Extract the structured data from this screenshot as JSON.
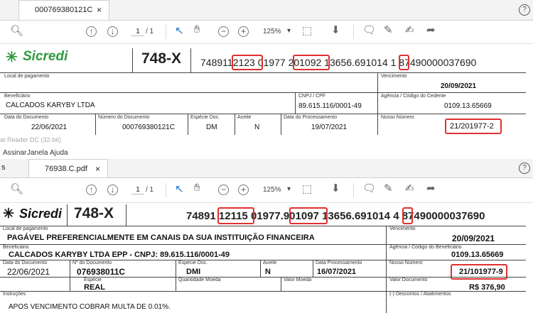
{
  "top": {
    "tab_label": "000769380121C",
    "tab_close": "×",
    "help": "?",
    "page_current": "1",
    "page_total": "/ 1",
    "zoom": "125%",
    "icons": [
      "zoom-search-icon",
      "page-up-icon",
      "page-down-icon",
      "cursor-icon",
      "hand-icon",
      "zoom-out-icon",
      "zoom-in-icon",
      "fit-page-icon",
      "scroll-icon",
      "comment-icon",
      "pen-icon",
      "sign-icon",
      "share-icon"
    ],
    "logo": "Sicredi",
    "bank_code": "748-X",
    "barcode_parts": [
      "74891",
      "12123",
      "01977",
      "201092",
      "13656.691014",
      "1",
      "87490000037690"
    ],
    "local_pagamento_label": "Local de pagamento",
    "vencimento_label": "Vencimento",
    "vencimento": "20/09/2021",
    "beneficiario_label": "Beneficiário",
    "beneficiario": "CALCADOS KARYBY LTDA",
    "cnpj_label": "CNPJ / CPF",
    "cnpj": "89.615.116/0001-49",
    "agencia_label": "Agência / Código do Cedente",
    "agencia": "0109.13.65669",
    "data_doc_label": "Data do Documento",
    "data_doc": "22/06/2021",
    "num_doc_label": "Número do Documento",
    "num_doc": "000769380121C",
    "especie_doc_label": "Espécie Doc.",
    "especie_doc": "DM",
    "aceite_label": "Aceite",
    "aceite": "N",
    "data_proc_label": "Data do Processamento",
    "data_proc": "19/07/2021",
    "nosso_numero_label": "Nosso Número",
    "nosso_numero": "21/201977-2"
  },
  "middle": {
    "caption": "at Reader DC (32-bit)",
    "menu": [
      "Assinar",
      "Janela",
      "Ajuda"
    ]
  },
  "bottom": {
    "tab_prefix": "s",
    "tab_label": "76938.C.pdf",
    "tab_close": "×",
    "help": "?",
    "page_current": "1",
    "page_total": "/ 1",
    "zoom": "125%",
    "logo": "Sicredi",
    "bank_code": "748-X",
    "barcode_parts": [
      "74891",
      "12115",
      "01977.",
      "901097",
      "13656.691014",
      "4",
      "87490000037690"
    ],
    "local_pagamento_label": "Local de pagamento",
    "local_pagamento": "PAGÁVEL PREFERENCIALMENTE EM CANAIS DA SUA INSTITUIÇÃO FINANCEIRA",
    "vencimento_label": "Vencimento",
    "vencimento": "20/09/2021",
    "beneficiario_label": "Beneficiário",
    "beneficiario": "CALCADOS KARYBY LTDA EPP - CNPJ: 89.615.116/0001-49",
    "agencia_label": "Agência / Código do Beneficiário",
    "agencia": "0109.13.65669",
    "data_doc_label": "Data do Documento",
    "data_doc": "22/06/2021",
    "num_doc_label": "Nº do Documento",
    "num_doc": "076938011C",
    "especie_doc_label": "Espécie Doc.",
    "especie_doc": "DMI",
    "aceite_label": "Aceite",
    "aceite": "N",
    "data_proc_label": "Data Processamento",
    "data_proc": "16/07/2021",
    "nosso_numero_label": "Nosso Número",
    "nosso_numero": "21/101977-9",
    "especie_label": "Espécie",
    "especie": "REAL",
    "qtd_moeda_label": "Quantidade Moeda",
    "valor_moeda_label": "Valor Moeda",
    "valor_doc_label": "Valor Documento",
    "valor_doc": "R$ 376,90",
    "instrucoes_label": "Instruções",
    "instrucoes": "APOS VENCIMENTO COBRAR MULTA DE 0.01%.",
    "descontos_label": "(-) Descontos / Abatimentos"
  },
  "colors": {
    "highlight": "#e03030",
    "brand_green": "#2e9a3e",
    "tab_bg": "#f3f3f3"
  }
}
